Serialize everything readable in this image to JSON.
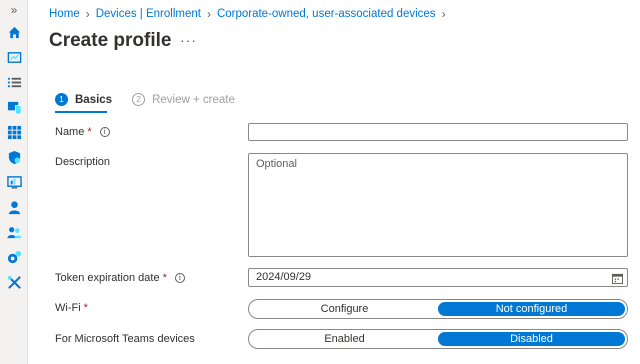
{
  "rail": {
    "expand": "»",
    "icons": [
      "home-icon",
      "dashboard-icon",
      "all-services-icon",
      "devices-icon",
      "apps-icon",
      "endpoint-security-icon",
      "reports-icon",
      "users-icon",
      "groups-icon",
      "tenant-admin-icon",
      "troubleshooting-icon"
    ]
  },
  "breadcrumb": [
    "Home",
    "Devices | Enrollment",
    "Corporate-owned, user-associated devices"
  ],
  "page": {
    "title": "Create profile",
    "more": "···"
  },
  "steps": [
    {
      "num": "1",
      "label": "Basics"
    },
    {
      "num": "2",
      "label": "Review + create"
    }
  ],
  "form": {
    "name_label": "Name",
    "name_value": "",
    "description_label": "Description",
    "description_placeholder": "Optional",
    "token_label": "Token expiration date",
    "token_value": "2024/09/29",
    "wifi_label": "Wi-Fi",
    "wifi_options": [
      "Configure",
      "Not configured"
    ],
    "wifi_selected": "Not configured",
    "teams_label": "For Microsoft Teams devices",
    "teams_options": [
      "Enabled",
      "Disabled"
    ],
    "teams_selected": "Disabled",
    "required_mark": "*",
    "info_mark": "i"
  },
  "colors": {
    "accent": "#0078d4",
    "required": "#a4262c"
  }
}
